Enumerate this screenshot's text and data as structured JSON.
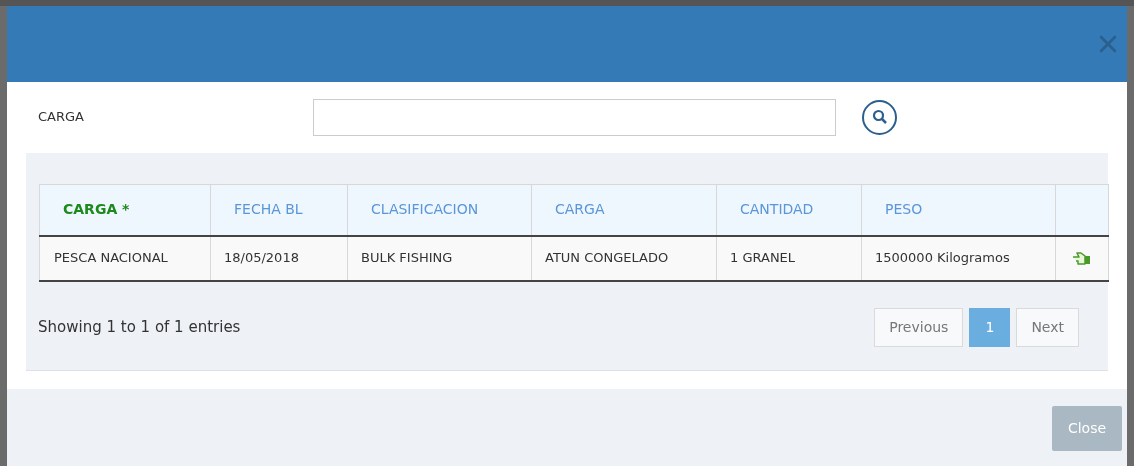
{
  "search": {
    "label": "CARGA"
  },
  "table": {
    "columns": [
      {
        "label": "CARGA *",
        "sorted": true
      },
      {
        "label": "FECHA BL",
        "sorted": false
      },
      {
        "label": "CLASIFICACION",
        "sorted": false
      },
      {
        "label": "CARGA",
        "sorted": false
      },
      {
        "label": "CANTIDAD",
        "sorted": false
      },
      {
        "label": "PESO",
        "sorted": false
      }
    ],
    "rows": [
      {
        "cells": [
          "PESCA NACIONAL",
          "18/05/2018",
          "BULK FISHING",
          "ATUN CONGELADO",
          "1 GRANEL",
          "1500000 Kilogramos"
        ]
      }
    ]
  },
  "info": "Showing 1 to 1 of 1 entries",
  "pagination": [
    {
      "label": "Previous",
      "kind": "nav",
      "selected": false
    },
    {
      "label": "1",
      "kind": "page",
      "selected": true
    },
    {
      "label": "Next",
      "kind": "nav",
      "selected": false
    }
  ],
  "footer_button": "Close"
}
